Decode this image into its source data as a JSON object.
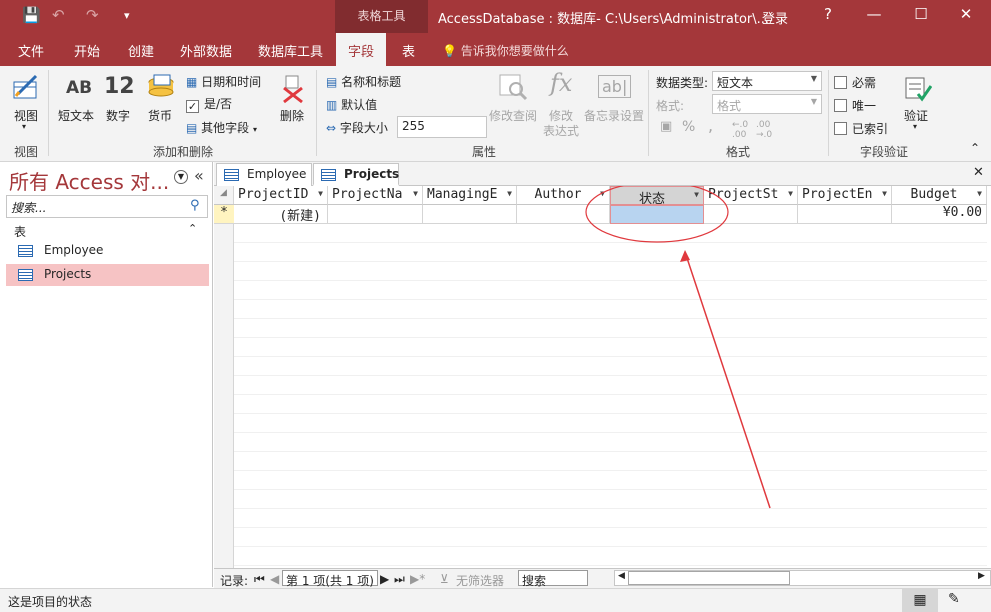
{
  "titlebar": {
    "context_tab": "表格工具",
    "title": "AccessDatabase : 数据库- C:\\Users\\Administrator\\...",
    "login": "登录",
    "help": "?",
    "minimize": "—",
    "maximize": "☐",
    "close": "✕",
    "qat_save": "💾",
    "qat_undo": "↶",
    "qat_redo": "↷",
    "qat_more": "▾"
  },
  "menu": {
    "tabs": [
      "文件",
      "开始",
      "创建",
      "外部数据",
      "数据库工具",
      "字段",
      "表"
    ],
    "active": "字段",
    "tell_me": "告诉我你想要做什么"
  },
  "ribbon": {
    "view": {
      "label": "视图",
      "group": "视图"
    },
    "add_delete": {
      "group": "添加和删除",
      "short_text_big": "AB",
      "short_text": "短文本",
      "number_big": "12",
      "number": "数字",
      "currency": "货币",
      "datetime": "日期和时间",
      "yesno": "是/否",
      "more_fields": "其他字段",
      "delete": "删除"
    },
    "properties": {
      "group": "属性",
      "name_caption": "名称和标题",
      "default_value": "默认值",
      "field_size_label": "字段大小",
      "field_size_value": "255",
      "modify_lookups": "修改查阅",
      "modify_expression_1": "修改",
      "modify_expression_2": "表达式",
      "memo_settings": "备忘录设置"
    },
    "formatting": {
      "group": "格式",
      "data_type_label": "数据类型:",
      "data_type_value": "短文本",
      "format_label": "格式:",
      "format_value": "格式",
      "percent": "%",
      "comma": ","
    },
    "validation": {
      "group": "字段验证",
      "required": "必需",
      "unique": "唯一",
      "indexed": "已索引",
      "validate": "验证"
    }
  },
  "nav": {
    "title": "所有 Access 对...",
    "search_placeholder": "搜索...",
    "section": "表",
    "items": [
      "Employee",
      "Projects"
    ],
    "selected": "Projects"
  },
  "doctabs": [
    "Employee",
    "Projects"
  ],
  "active_doc": "Projects",
  "sheet": {
    "columns": [
      "ProjectID",
      "ProjectNa",
      "ManagingE",
      "Author",
      "状态",
      "ProjectSt",
      "ProjectEn",
      "Budget"
    ],
    "selected_column": "状态",
    "new_row_marker": "*",
    "new_row_label": "(新建)",
    "budget_default": "¥0.00"
  },
  "recnav": {
    "label": "记录:",
    "position": "第 1 项(共 1 项)",
    "filter": "无筛选器",
    "search": "搜索"
  },
  "status": {
    "text": "这是项目的状态"
  },
  "annotation_color": "#e0393e"
}
